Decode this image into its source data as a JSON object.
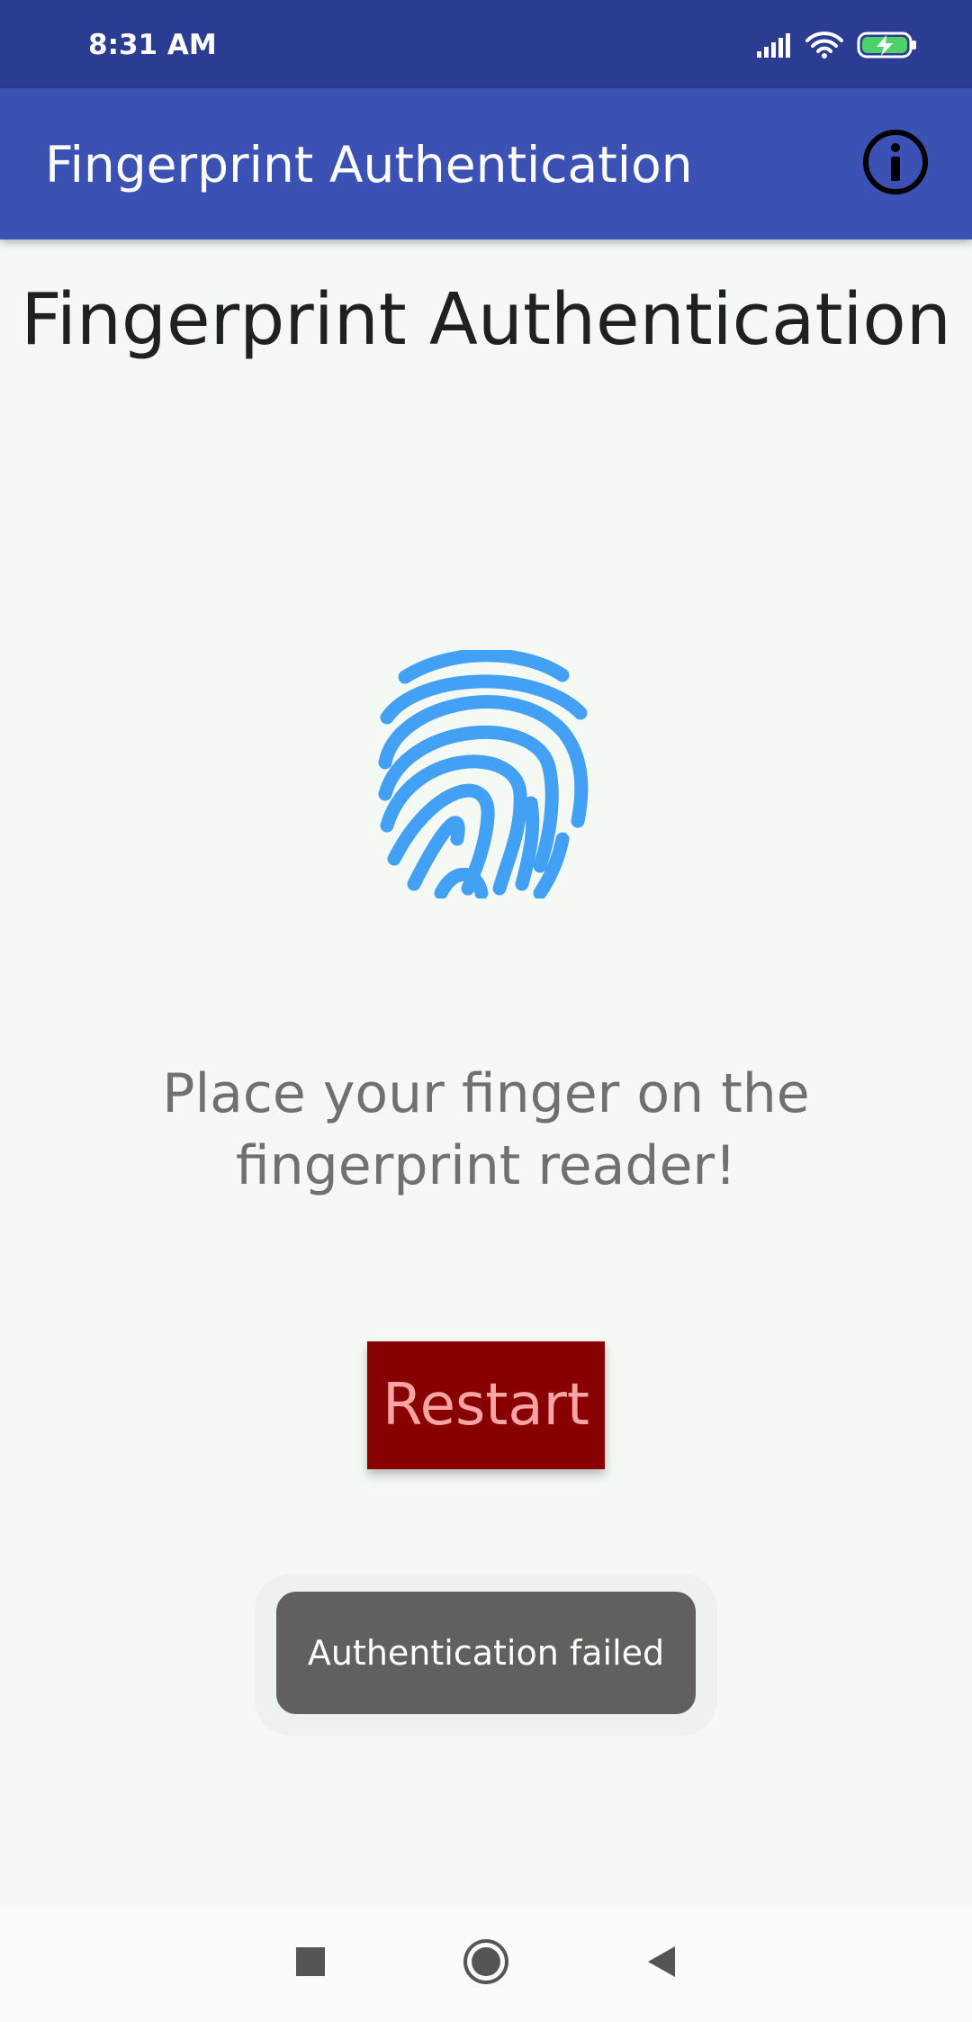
{
  "status_bar": {
    "time": "8:31 AM",
    "icons": [
      "signal-icon",
      "wifi-icon",
      "battery-charging-icon"
    ]
  },
  "app_bar": {
    "title": "Fingerprint Authentication",
    "action_icon": "info-icon"
  },
  "main": {
    "heading": "Fingerprint Authentication",
    "fingerprint_icon": "fingerprint-icon",
    "fingerprint_color": "#42a0f5",
    "instruction": "Place your finger on the fingerprint reader!",
    "restart_label": "Restart",
    "restart_bg": "#880000",
    "restart_text_color": "#f6a4a4"
  },
  "toast": {
    "message": "Authentication failed"
  },
  "nav_bar": {
    "buttons": [
      "recents-square-icon",
      "home-circle-icon",
      "back-triangle-icon"
    ]
  }
}
